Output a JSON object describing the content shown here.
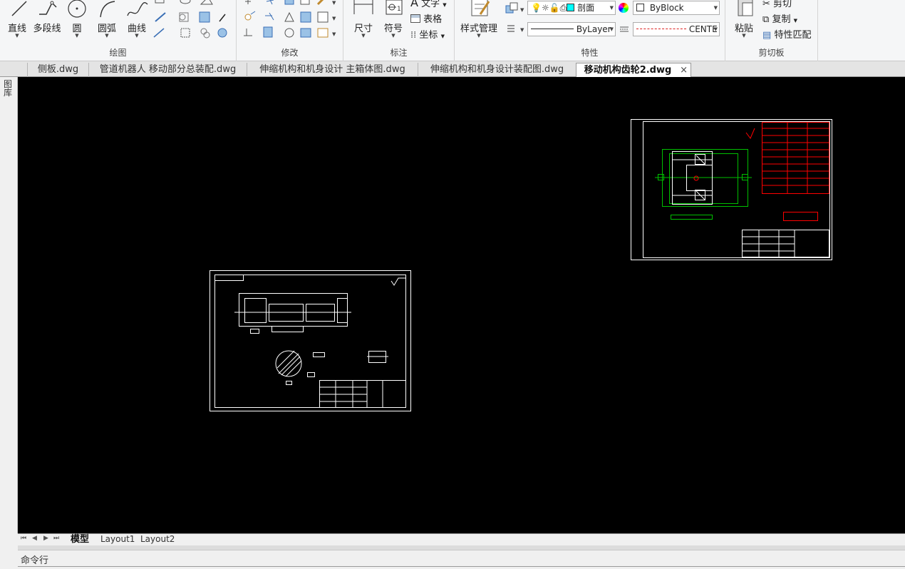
{
  "ribbon": {
    "draw_panel": {
      "title": "绘图",
      "buttons": [
        {
          "label": "直线",
          "icon": "line-icon"
        },
        {
          "label": "多段线",
          "icon": "polyline-icon"
        },
        {
          "label": "圆",
          "icon": "circle-icon"
        },
        {
          "label": "圆弧",
          "icon": "arc-icon"
        },
        {
          "label": "曲线",
          "icon": "spline-icon"
        }
      ]
    },
    "modify_panel": {
      "title": "修改"
    },
    "annotation_panel": {
      "title": "标注",
      "dimension_label": "尺寸",
      "symbol_label": "符号",
      "text_label": "文字",
      "table_label": "表格",
      "coordinate_label": "坐标"
    },
    "properties_panel": {
      "title": "特性",
      "style_manager_label": "样式管理",
      "layer_value": "剖面",
      "color_value": "ByBlock",
      "lineweight_value": "ByLayer",
      "linetype_value": "CENTE"
    },
    "clipboard_panel": {
      "title": "剪切板",
      "paste_label": "粘贴",
      "cut_label": "剪切",
      "copy_label": "复制",
      "match_label": "特性匹配"
    }
  },
  "file_tabs": [
    {
      "label": "侧板.dwg",
      "active": false
    },
    {
      "label": "管道机器人 移动部分总装配.dwg",
      "active": false
    },
    {
      "label": "伸缩机构和机身设计 主箱体图.dwg",
      "active": false
    },
    {
      "label": "伸缩机构和机身设计装配图.dwg",
      "active": false
    },
    {
      "label": "移动机构齿轮2.dwg",
      "active": true
    }
  ],
  "left_strip_label": "图库",
  "layout_tabs": [
    {
      "label": "模型",
      "active": true
    },
    {
      "label": "Layout1",
      "active": false
    },
    {
      "label": "Layout2",
      "active": false
    }
  ],
  "command_line_label": "命令行",
  "colors": {
    "canvas_bg": "#000000",
    "drawing_white": "#ffffff",
    "drawing_red": "#ff0000",
    "drawing_green": "#00c000",
    "layer_color_swatch": "#00ffff"
  }
}
